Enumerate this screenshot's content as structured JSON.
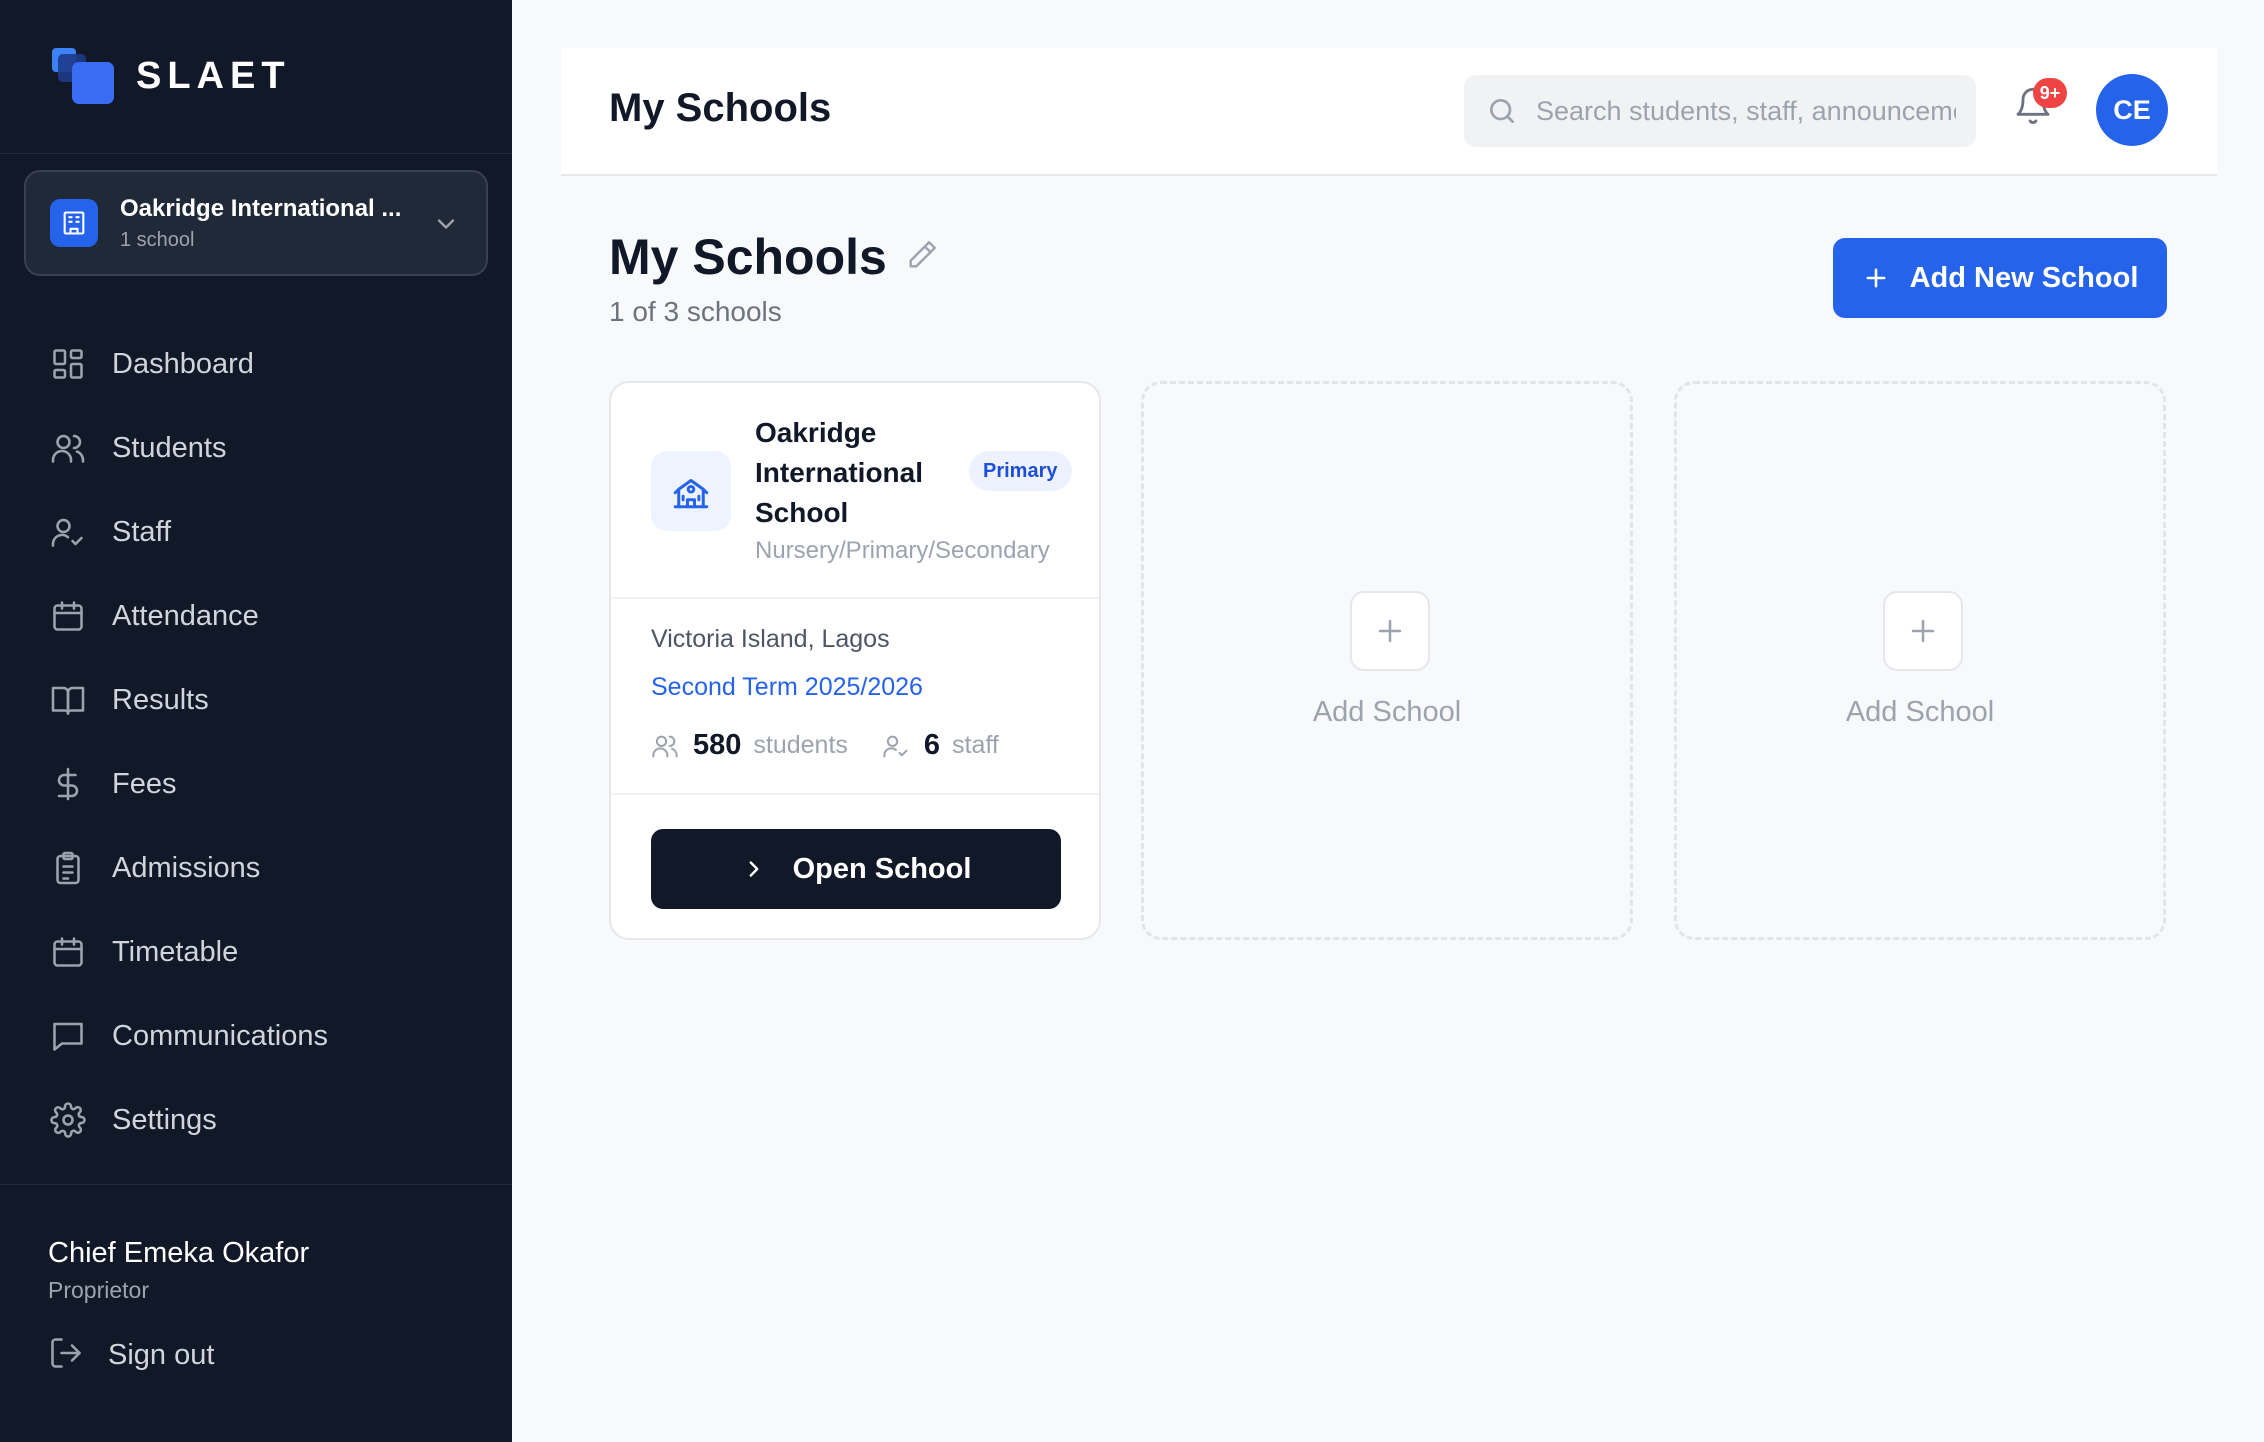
{
  "brand": {
    "name": "SLAET"
  },
  "school_switcher": {
    "name": "Oakridge International ...",
    "count": "1 school"
  },
  "nav": [
    {
      "label": "Dashboard",
      "icon": "dashboard-icon"
    },
    {
      "label": "Students",
      "icon": "students-icon"
    },
    {
      "label": "Staff",
      "icon": "staff-icon"
    },
    {
      "label": "Attendance",
      "icon": "calendar-icon"
    },
    {
      "label": "Results",
      "icon": "book-icon"
    },
    {
      "label": "Fees",
      "icon": "dollar-icon"
    },
    {
      "label": "Admissions",
      "icon": "clipboard-icon"
    },
    {
      "label": "Timetable",
      "icon": "calendar-icon"
    },
    {
      "label": "Communications",
      "icon": "message-icon"
    },
    {
      "label": "Settings",
      "icon": "gear-icon"
    }
  ],
  "user": {
    "name": "Chief Emeka Okafor",
    "role": "Proprietor",
    "signout_label": "Sign out"
  },
  "topbar": {
    "title": "My Schools",
    "search_placeholder": "Search students, staff, announcements...",
    "notification_badge": "9+",
    "avatar_initials": "CE"
  },
  "main": {
    "heading": "My Schools",
    "subtitle": "1 of 3 schools",
    "add_button_label": "Add New School"
  },
  "school_card": {
    "name": "Oakridge International School",
    "badge": "Primary",
    "levels": "Nursery/Primary/Secondary",
    "location": "Victoria Island, Lagos",
    "term": "Second Term 2025/2026",
    "students_count": "580",
    "students_label": "students",
    "staff_count": "6",
    "staff_label": "staff",
    "open_label": "Open School"
  },
  "placeholders": [
    {
      "label": "Add School"
    },
    {
      "label": "Add School"
    }
  ],
  "colors": {
    "sidebar_bg": "#111827",
    "accent": "#2563eb",
    "badge_red": "#ef4444",
    "page_bg": "#f8f9fb"
  }
}
